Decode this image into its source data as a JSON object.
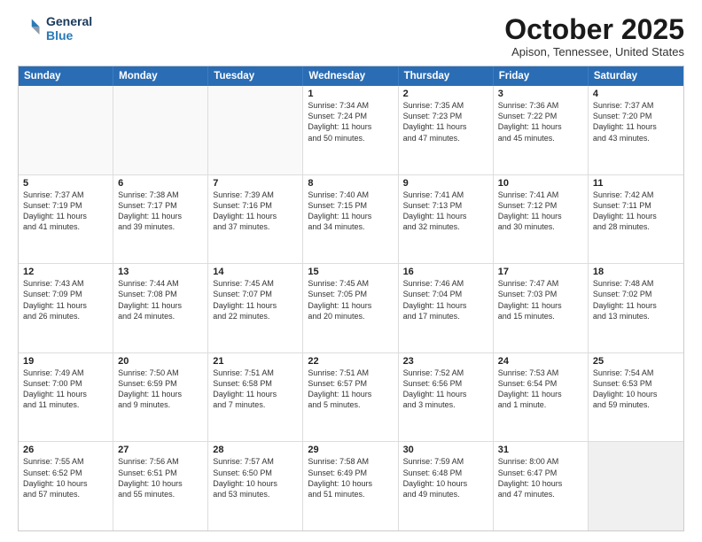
{
  "logo": {
    "line1": "General",
    "line2": "Blue"
  },
  "title": "October 2025",
  "location": "Apison, Tennessee, United States",
  "days_of_week": [
    "Sunday",
    "Monday",
    "Tuesday",
    "Wednesday",
    "Thursday",
    "Friday",
    "Saturday"
  ],
  "weeks": [
    [
      {
        "day": "",
        "empty": true
      },
      {
        "day": "",
        "empty": true
      },
      {
        "day": "",
        "empty": true
      },
      {
        "day": "1",
        "lines": [
          "Sunrise: 7:34 AM",
          "Sunset: 7:24 PM",
          "Daylight: 11 hours",
          "and 50 minutes."
        ]
      },
      {
        "day": "2",
        "lines": [
          "Sunrise: 7:35 AM",
          "Sunset: 7:23 PM",
          "Daylight: 11 hours",
          "and 47 minutes."
        ]
      },
      {
        "day": "3",
        "lines": [
          "Sunrise: 7:36 AM",
          "Sunset: 7:22 PM",
          "Daylight: 11 hours",
          "and 45 minutes."
        ]
      },
      {
        "day": "4",
        "lines": [
          "Sunrise: 7:37 AM",
          "Sunset: 7:20 PM",
          "Daylight: 11 hours",
          "and 43 minutes."
        ]
      }
    ],
    [
      {
        "day": "5",
        "lines": [
          "Sunrise: 7:37 AM",
          "Sunset: 7:19 PM",
          "Daylight: 11 hours",
          "and 41 minutes."
        ]
      },
      {
        "day": "6",
        "lines": [
          "Sunrise: 7:38 AM",
          "Sunset: 7:17 PM",
          "Daylight: 11 hours",
          "and 39 minutes."
        ]
      },
      {
        "day": "7",
        "lines": [
          "Sunrise: 7:39 AM",
          "Sunset: 7:16 PM",
          "Daylight: 11 hours",
          "and 37 minutes."
        ]
      },
      {
        "day": "8",
        "lines": [
          "Sunrise: 7:40 AM",
          "Sunset: 7:15 PM",
          "Daylight: 11 hours",
          "and 34 minutes."
        ]
      },
      {
        "day": "9",
        "lines": [
          "Sunrise: 7:41 AM",
          "Sunset: 7:13 PM",
          "Daylight: 11 hours",
          "and 32 minutes."
        ]
      },
      {
        "day": "10",
        "lines": [
          "Sunrise: 7:41 AM",
          "Sunset: 7:12 PM",
          "Daylight: 11 hours",
          "and 30 minutes."
        ]
      },
      {
        "day": "11",
        "lines": [
          "Sunrise: 7:42 AM",
          "Sunset: 7:11 PM",
          "Daylight: 11 hours",
          "and 28 minutes."
        ]
      }
    ],
    [
      {
        "day": "12",
        "lines": [
          "Sunrise: 7:43 AM",
          "Sunset: 7:09 PM",
          "Daylight: 11 hours",
          "and 26 minutes."
        ]
      },
      {
        "day": "13",
        "lines": [
          "Sunrise: 7:44 AM",
          "Sunset: 7:08 PM",
          "Daylight: 11 hours",
          "and 24 minutes."
        ]
      },
      {
        "day": "14",
        "lines": [
          "Sunrise: 7:45 AM",
          "Sunset: 7:07 PM",
          "Daylight: 11 hours",
          "and 22 minutes."
        ]
      },
      {
        "day": "15",
        "lines": [
          "Sunrise: 7:45 AM",
          "Sunset: 7:05 PM",
          "Daylight: 11 hours",
          "and 20 minutes."
        ]
      },
      {
        "day": "16",
        "lines": [
          "Sunrise: 7:46 AM",
          "Sunset: 7:04 PM",
          "Daylight: 11 hours",
          "and 17 minutes."
        ]
      },
      {
        "day": "17",
        "lines": [
          "Sunrise: 7:47 AM",
          "Sunset: 7:03 PM",
          "Daylight: 11 hours",
          "and 15 minutes."
        ]
      },
      {
        "day": "18",
        "lines": [
          "Sunrise: 7:48 AM",
          "Sunset: 7:02 PM",
          "Daylight: 11 hours",
          "and 13 minutes."
        ]
      }
    ],
    [
      {
        "day": "19",
        "lines": [
          "Sunrise: 7:49 AM",
          "Sunset: 7:00 PM",
          "Daylight: 11 hours",
          "and 11 minutes."
        ]
      },
      {
        "day": "20",
        "lines": [
          "Sunrise: 7:50 AM",
          "Sunset: 6:59 PM",
          "Daylight: 11 hours",
          "and 9 minutes."
        ]
      },
      {
        "day": "21",
        "lines": [
          "Sunrise: 7:51 AM",
          "Sunset: 6:58 PM",
          "Daylight: 11 hours",
          "and 7 minutes."
        ]
      },
      {
        "day": "22",
        "lines": [
          "Sunrise: 7:51 AM",
          "Sunset: 6:57 PM",
          "Daylight: 11 hours",
          "and 5 minutes."
        ]
      },
      {
        "day": "23",
        "lines": [
          "Sunrise: 7:52 AM",
          "Sunset: 6:56 PM",
          "Daylight: 11 hours",
          "and 3 minutes."
        ]
      },
      {
        "day": "24",
        "lines": [
          "Sunrise: 7:53 AM",
          "Sunset: 6:54 PM",
          "Daylight: 11 hours",
          "and 1 minute."
        ]
      },
      {
        "day": "25",
        "lines": [
          "Sunrise: 7:54 AM",
          "Sunset: 6:53 PM",
          "Daylight: 10 hours",
          "and 59 minutes."
        ]
      }
    ],
    [
      {
        "day": "26",
        "lines": [
          "Sunrise: 7:55 AM",
          "Sunset: 6:52 PM",
          "Daylight: 10 hours",
          "and 57 minutes."
        ]
      },
      {
        "day": "27",
        "lines": [
          "Sunrise: 7:56 AM",
          "Sunset: 6:51 PM",
          "Daylight: 10 hours",
          "and 55 minutes."
        ]
      },
      {
        "day": "28",
        "lines": [
          "Sunrise: 7:57 AM",
          "Sunset: 6:50 PM",
          "Daylight: 10 hours",
          "and 53 minutes."
        ]
      },
      {
        "day": "29",
        "lines": [
          "Sunrise: 7:58 AM",
          "Sunset: 6:49 PM",
          "Daylight: 10 hours",
          "and 51 minutes."
        ]
      },
      {
        "day": "30",
        "lines": [
          "Sunrise: 7:59 AM",
          "Sunset: 6:48 PM",
          "Daylight: 10 hours",
          "and 49 minutes."
        ]
      },
      {
        "day": "31",
        "lines": [
          "Sunrise: 8:00 AM",
          "Sunset: 6:47 PM",
          "Daylight: 10 hours",
          "and 47 minutes."
        ]
      },
      {
        "day": "",
        "empty": true,
        "shaded": true
      }
    ]
  ]
}
